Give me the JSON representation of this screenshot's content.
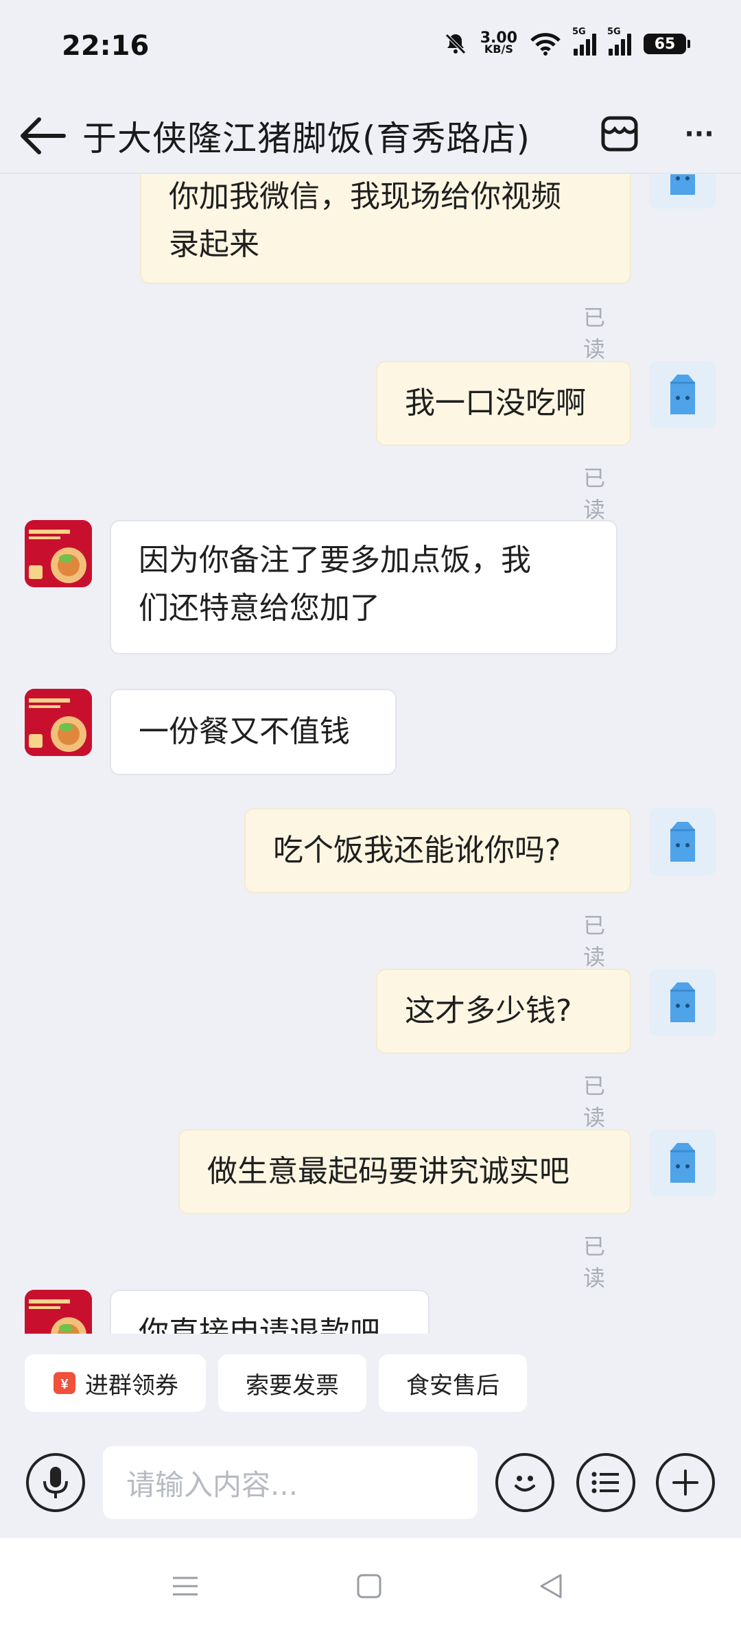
{
  "status_bar": {
    "time": "22:16",
    "net_speed_value": "3.00",
    "net_speed_unit": "KB/S",
    "signal1_label": "5G",
    "signal2_label": "5G",
    "battery": "65",
    "icons": [
      "mute-bell-icon",
      "wifi-icon",
      "signal-icon",
      "battery-icon"
    ]
  },
  "header": {
    "title": "于大侠隆江猪脚饭(育秀路店)",
    "more_label": "···"
  },
  "messages": [
    {
      "side": "out",
      "lines": [
        "你加我微信，我现场给你视频",
        "录起来"
      ],
      "read": "已读"
    },
    {
      "side": "out",
      "text": "我一口没吃啊",
      "read": "已读"
    },
    {
      "side": "in",
      "lines": [
        "因为你备注了要多加点饭，我",
        "们还特意给您加了"
      ]
    },
    {
      "side": "in",
      "text": "一份餐又不值钱"
    },
    {
      "side": "out",
      "text": "吃个饭我还能讹你吗?",
      "read": "已读"
    },
    {
      "side": "out",
      "text": "这才多少钱?",
      "read": "已读"
    },
    {
      "side": "out",
      "text": "做生意最起码要讲究诚实吧",
      "read": "已读"
    },
    {
      "side": "in",
      "text": "你直接申请退款吧"
    }
  ],
  "quick_actions": [
    {
      "label": "进群领券",
      "icon": "coupon-icon"
    },
    {
      "label": "索要发票"
    },
    {
      "label": "食安售后"
    }
  ],
  "input": {
    "placeholder": "请输入内容..."
  },
  "colors": {
    "background": "#eef0f6",
    "outgoing_bubble": "#fdf6e3",
    "incoming_bubble": "#ffffff",
    "coupon_accent": "#f0503c",
    "avatar_blue": "#4fa3e8",
    "shop_red": "#c8102e"
  }
}
